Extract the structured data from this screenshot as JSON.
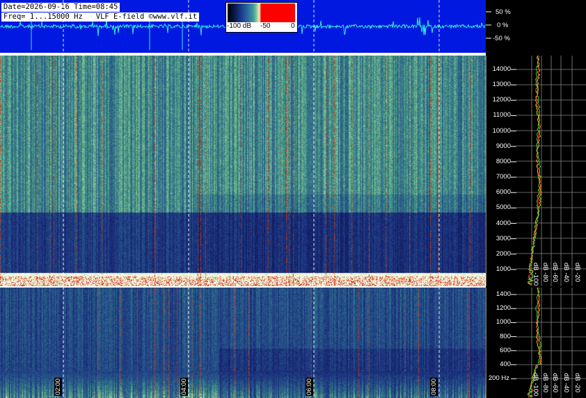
{
  "header": {
    "line1": "Date=2026-09-16 Time=08:45",
    "line2": "Freq= 1...15000 Hz   VLF E-field ©www.vlf.it"
  },
  "colorbar": {
    "labels": [
      "-100 dB",
      "-50",
      "0"
    ]
  },
  "waveform_scale": [
    "50 %",
    "0 %",
    "-50 %"
  ],
  "upper_freq_ticks": [
    "14000",
    "13000",
    "12000",
    "11000",
    "10000",
    "9000",
    "8000",
    "7000",
    "6000",
    "5000",
    "4000",
    "3000",
    "2000",
    "1000"
  ],
  "lower_freq_ticks": [
    "1400",
    "1200",
    "1000",
    "800",
    "600",
    "400",
    "200 Hz"
  ],
  "time_labels": [
    "02:00",
    "04:00",
    "06:00",
    "08:00"
  ],
  "upper_db_labels": [
    "dB -100",
    "dB -80",
    "dB -60",
    "dB -40",
    "dB -20"
  ],
  "lower_db_labels": [
    "dB -100",
    "dB -80",
    "dB -60",
    "dB -40",
    "dB -20"
  ],
  "colors": {
    "waveform_bg": "#0018e0",
    "trace": "#2ef0e0",
    "spec_dark": "#18246a"
  }
}
